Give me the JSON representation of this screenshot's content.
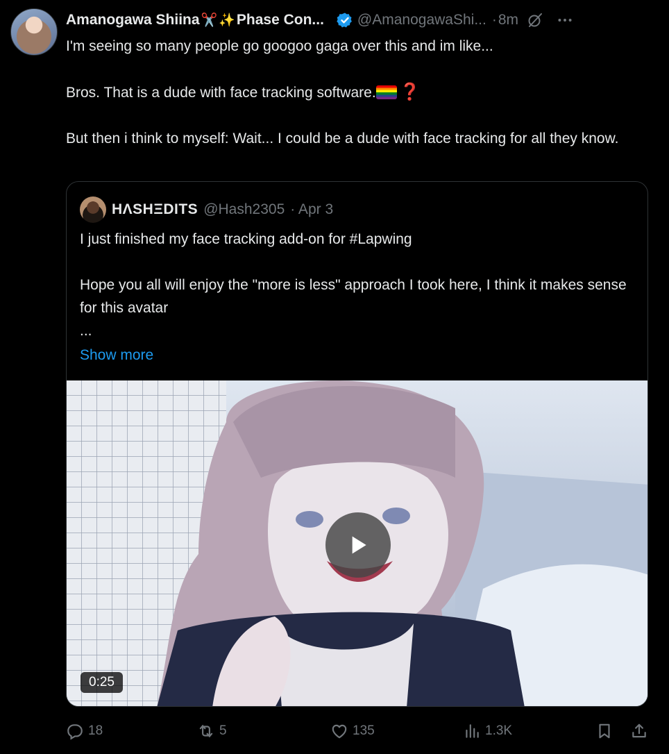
{
  "tweet": {
    "author_name": "Amanogawa Shiina",
    "emoji_scissors": "✂️",
    "emoji_sparkles": "✨",
    "author_name_suffix": "Phase Con...",
    "handle": "@AmanogawaShi...",
    "separator": "·",
    "time": "8m",
    "paragraphs": [
      "I'm seeing so many people go googoo gaga over this and im like...",
      "Bros. That is a dude with face tracking software.",
      "But then i think to myself: Wait... I could be a dude with face tracking for all they know."
    ],
    "question_mark": "❓"
  },
  "quote": {
    "author_name": "HΛSHΞDITS",
    "handle": "@Hash2305",
    "date": "· Apr 3",
    "paragraphs": [
      "I just finished my face tracking add-on for #Lapwing",
      "Hope you all will enjoy the \"more is less\" approach I took here, I think it makes sense for this avatar",
      "..."
    ],
    "show_more": "Show more",
    "video_duration": "0:25"
  },
  "actions": {
    "replies": "18",
    "reposts": "5",
    "likes": "135",
    "views": "1.3K"
  },
  "icons": [
    "verified-badge-icon",
    "grok-icon",
    "more-icon",
    "play-icon",
    "reply-icon",
    "repost-icon",
    "like-icon",
    "views-icon",
    "bookmark-icon",
    "share-icon"
  ],
  "colors": {
    "background": "#000000",
    "text": "#e7e9ea",
    "secondary": "#71767b",
    "link": "#1d9bf0",
    "verified": "#1d9bf0"
  }
}
